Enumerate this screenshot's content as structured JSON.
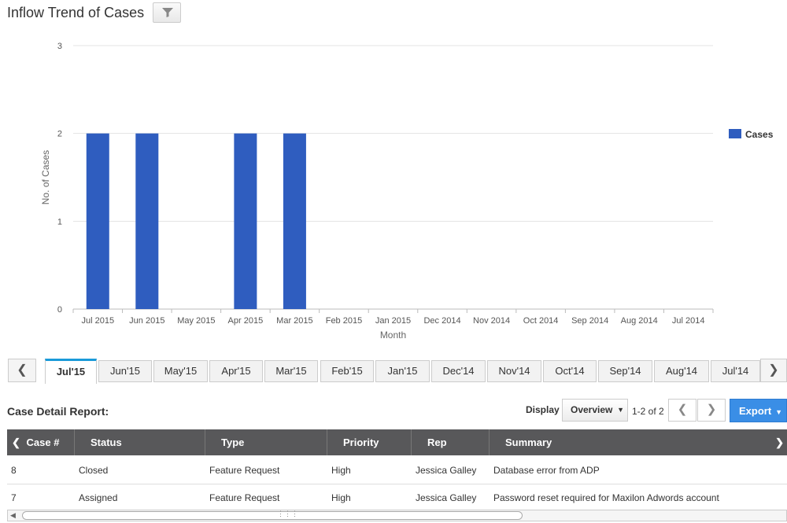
{
  "header": {
    "title": "Inflow Trend of Cases",
    "filter_icon": "filter-icon"
  },
  "chart_data": {
    "type": "bar",
    "categories": [
      "Jul 2015",
      "Jun 2015",
      "May 2015",
      "Apr 2015",
      "Mar 2015",
      "Feb 2015",
      "Jan 2015",
      "Dec 2014",
      "Nov 2014",
      "Oct 2014",
      "Sep 2014",
      "Aug 2014",
      "Jul 2014"
    ],
    "series": [
      {
        "name": "Cases",
        "values": [
          2,
          2,
          0,
          2,
          2,
          0,
          0,
          0,
          0,
          0,
          0,
          0,
          0
        ],
        "color": "#2f5dbf"
      }
    ],
    "xlabel": "Month",
    "ylabel": "No. of Cases",
    "ylim": [
      0,
      3
    ],
    "yticks": [
      0,
      1,
      2,
      3
    ],
    "grid": true,
    "legend": "right"
  },
  "month_tabs": {
    "items": [
      "Jul'15",
      "Jun'15",
      "May'15",
      "Apr'15",
      "Mar'15",
      "Feb'15",
      "Jan'15",
      "Dec'14",
      "Nov'14",
      "Oct'14",
      "Sep'14",
      "Aug'14",
      "Jul'14"
    ],
    "active_index": 0,
    "prev_icon": "chevron-left-icon",
    "next_icon": "chevron-right-icon"
  },
  "report": {
    "title": "Case Detail Report:",
    "display_label": "Display",
    "display_value": "Overview",
    "page_count": "1-2 of 2",
    "export_label": "Export"
  },
  "table": {
    "columns": [
      "Case #",
      "Status",
      "Type",
      "Priority",
      "Rep",
      "Summary"
    ],
    "rows": [
      {
        "case": "8",
        "status": "Closed",
        "type": "Feature Request",
        "priority": "High",
        "rep": "Jessica Galley",
        "summary": "Database error from ADP"
      },
      {
        "case": "7",
        "status": "Assigned",
        "type": "Feature Request",
        "priority": "High",
        "rep": "Jessica Galley",
        "summary": "Password reset required for Maxilon Adwords account"
      }
    ]
  }
}
